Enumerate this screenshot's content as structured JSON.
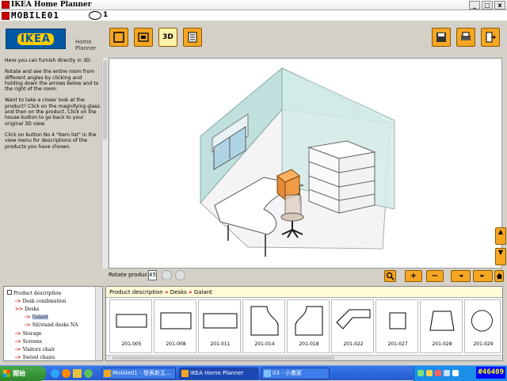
{
  "window": {
    "title": "IKEA Home Planner",
    "watermark": "MOBILE01",
    "menu_number": "1"
  },
  "brand": {
    "logo": "IKEA",
    "app_line1": "Home",
    "app_line2": "Planner"
  },
  "toolbar": {
    "left_buttons": [
      "floor-plan-icon",
      "room-edit-icon",
      "3d-view-icon",
      "item-list-icon"
    ],
    "view_3d_label": "3D",
    "right_buttons": [
      "save-icon",
      "print-icon",
      "exit-icon"
    ]
  },
  "help": {
    "paragraphs": [
      "Here you can furnish directly in 3D.",
      "Rotate and see the entire room from different angles by clicking and holding down the arrows below and to the right of the room.",
      "Want to take a closer look at the product? Click on the magnifying glass and then on the product. Click on the house button to go back to your original 3D view.",
      "Click on button No 4 \"Item list\" in the view menu for descriptions of the products you have chosen."
    ]
  },
  "rotate": {
    "label": "Rotate product:",
    "value": "45"
  },
  "view_controls": {
    "zoom": "magnifier-icon",
    "zoom_in": "+",
    "zoom_out": "−",
    "move_left": "◄",
    "move_right": "►",
    "home": "house-icon",
    "up": "▲",
    "down": "▼"
  },
  "tree": {
    "items": [
      {
        "label": "Product description",
        "level": 0
      },
      {
        "label": "Desk combination",
        "level": 1
      },
      {
        "label": "Desks",
        "level": 1
      },
      {
        "label": "Galant",
        "level": 2
      },
      {
        "label": "Sit/stand desks NA",
        "level": 2
      },
      {
        "label": "Storage",
        "level": 1
      },
      {
        "label": "Screens",
        "level": 1
      },
      {
        "label": "Visitors chair",
        "level": 1
      },
      {
        "label": "Swivel chairs",
        "level": 1
      }
    ]
  },
  "breadcrumb": {
    "items": [
      "Product description",
      "Desks",
      "Galant"
    ],
    "separator": "»"
  },
  "products": [
    {
      "code": "201-005",
      "shape": "rect-wide"
    },
    {
      "code": "201-008",
      "shape": "rect-mid"
    },
    {
      "code": "201-011",
      "shape": "rect-long"
    },
    {
      "code": "201-014",
      "shape": "curve-right"
    },
    {
      "code": "201-018",
      "shape": "curve-left"
    },
    {
      "code": "201-022",
      "shape": "corner-angle"
    },
    {
      "code": "201-027",
      "shape": "square"
    },
    {
      "code": "201-028",
      "shape": "trapezoid"
    },
    {
      "code": "201-029",
      "shape": "circle"
    }
  ],
  "taskbar": {
    "start": "開始",
    "buttons": [
      {
        "label": "Mobile01 - 發表新主..."
      },
      {
        "label": "IKEA Home Planner"
      },
      {
        "label": "03 - 小畫家"
      }
    ],
    "clock": "#46409"
  },
  "colors": {
    "accent": "#f5a623",
    "brand_blue": "#0058a3",
    "brand_yellow": "#ffcc00",
    "wall": "#bfe0dc"
  }
}
